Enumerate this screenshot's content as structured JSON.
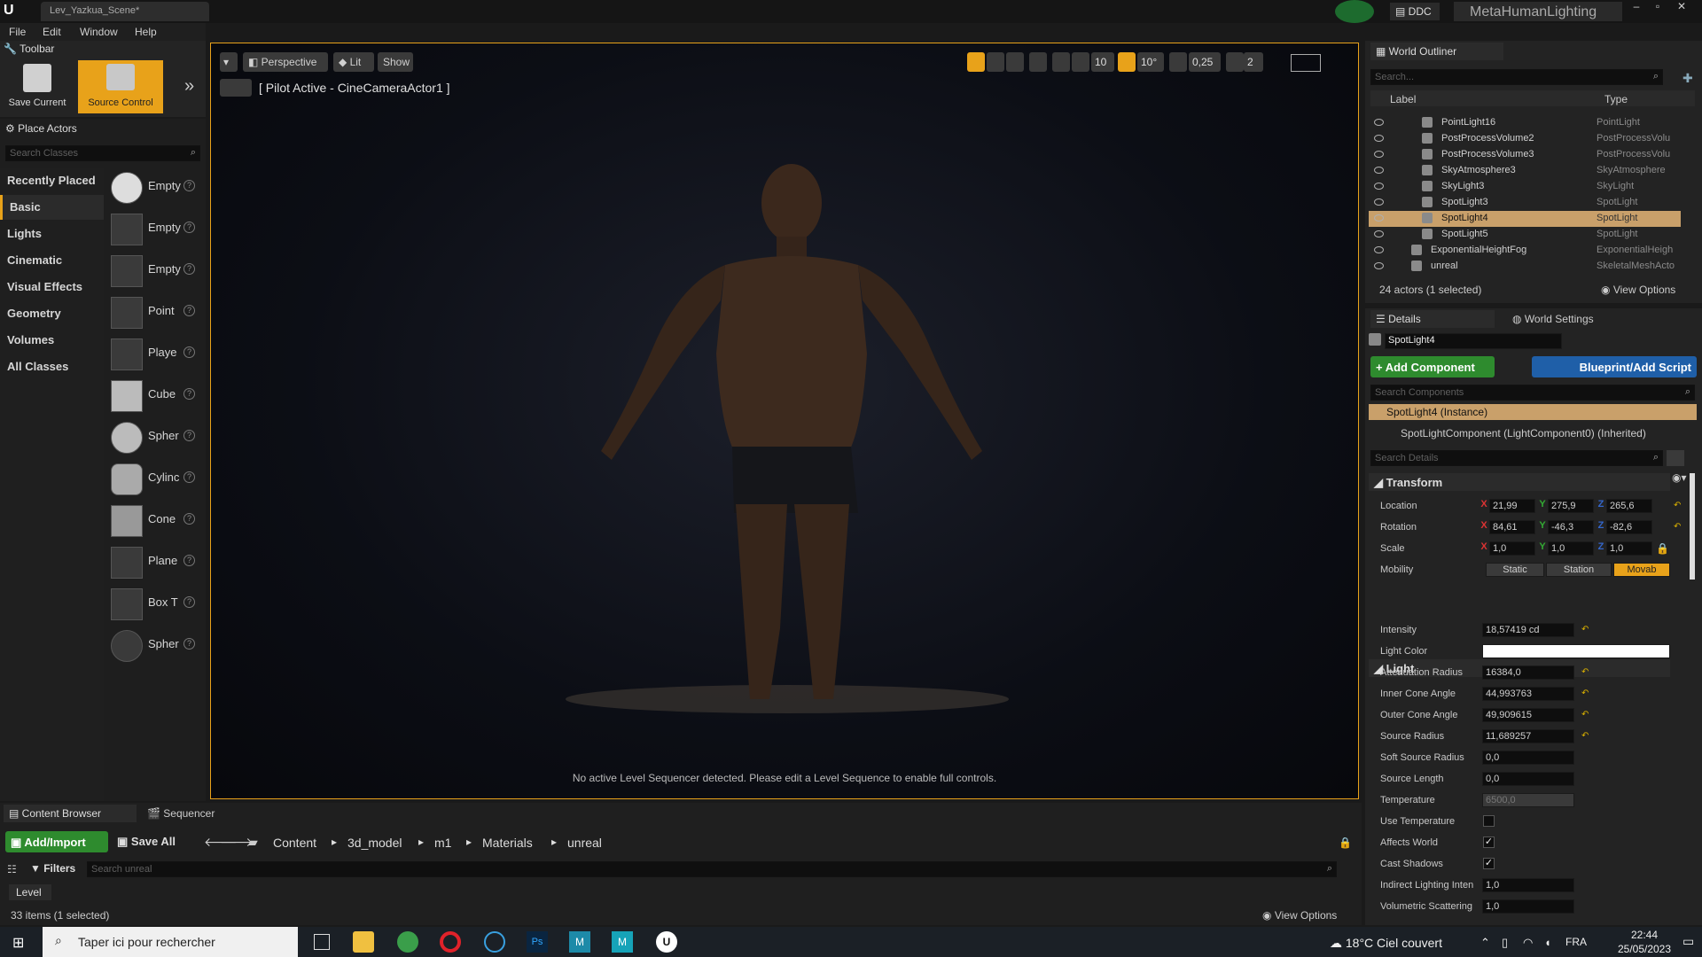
{
  "window": {
    "tab_title": "Lev_Yazkua_Scene*",
    "ddc": "DDC",
    "project": "MetaHumanLighting"
  },
  "menu": [
    "File",
    "Edit",
    "Window",
    "Help"
  ],
  "toolbar": {
    "tab": "Toolbar",
    "save": "Save Current",
    "source": "Source Control"
  },
  "place_actors": {
    "tab": "Place Actors",
    "search": "Search Classes",
    "categories": [
      "Recently Placed",
      "Basic",
      "Lights",
      "Cinematic",
      "Visual Effects",
      "Geometry",
      "Volumes",
      "All Classes"
    ],
    "items": [
      "Empty",
      "Empty",
      "Empty",
      "Point",
      "Playe",
      "Cube",
      "Spher",
      "Cylinc",
      "Cone",
      "Plane",
      "Box T",
      "Spher"
    ]
  },
  "viewport": {
    "perspective": "Perspective",
    "lit": "Lit",
    "show": "Show",
    "pilot": "[ Pilot Active - CineCameraActor1 ]",
    "grid": "10",
    "angle": "10°",
    "scale": "0,25",
    "cams": "2",
    "message": "No active Level Sequencer detected. Please edit a Level Sequence to enable full controls."
  },
  "outliner": {
    "tab": "World Outliner",
    "search": "Search...",
    "col_label": "Label",
    "col_type": "Type",
    "rows": [
      {
        "n": "PointLight16",
        "t": "PointLight"
      },
      {
        "n": "PostProcessVolume2",
        "t": "PostProcessVolu"
      },
      {
        "n": "PostProcessVolume3",
        "t": "PostProcessVolu"
      },
      {
        "n": "SkyAtmosphere3",
        "t": "SkyAtmosphere"
      },
      {
        "n": "SkyLight3",
        "t": "SkyLight"
      },
      {
        "n": "SpotLight3",
        "t": "SpotLight"
      },
      {
        "n": "SpotLight4",
        "t": "SpotLight"
      },
      {
        "n": "SpotLight5",
        "t": "SpotLight"
      },
      {
        "n": "ExponentialHeightFog",
        "t": "ExponentialHeigh"
      },
      {
        "n": "unreal",
        "t": "SkeletalMeshActo"
      }
    ],
    "count": "24 actors (1 selected)",
    "view_options": "View Options"
  },
  "details": {
    "tab": "Details",
    "tab2": "World Settings",
    "name": "SpotLight4",
    "add": "+ Add Component",
    "bp": "Blueprint/Add Script",
    "search_comp": "Search Components",
    "instance": "SpotLight4 (Instance)",
    "component": "SpotLightComponent (LightComponent0) (Inherited)",
    "search_details": "Search Details",
    "transform": "Transform",
    "location": "Location",
    "rotation": "Rotation",
    "scale": "Scale",
    "mobility": "Mobility",
    "loc": [
      "21,99",
      "275,9",
      "265,6"
    ],
    "rot": [
      "84,61",
      "-46,3",
      "-82,6"
    ],
    "scl": [
      "1,0",
      "1,0",
      "1,0"
    ],
    "mob": [
      "Static",
      "Station",
      "Movab"
    ],
    "light": "Light",
    "props": [
      {
        "l": "Intensity",
        "v": "18,57419 cd"
      },
      {
        "l": "Light Color",
        "v": ""
      },
      {
        "l": "Attenuation Radius",
        "v": "16384,0"
      },
      {
        "l": "Inner Cone Angle",
        "v": "44,993763"
      },
      {
        "l": "Outer Cone Angle",
        "v": "49,909615"
      },
      {
        "l": "Source Radius",
        "v": "11,689257"
      },
      {
        "l": "Soft Source Radius",
        "v": "0,0"
      },
      {
        "l": "Source Length",
        "v": "0,0"
      },
      {
        "l": "Temperature",
        "v": "6500,0"
      },
      {
        "l": "Use Temperature",
        "v": ""
      },
      {
        "l": "Affects World",
        "v": ""
      },
      {
        "l": "Cast Shadows",
        "v": ""
      },
      {
        "l": "Indirect Lighting Inten",
        "v": "1,0"
      },
      {
        "l": "Volumetric Scattering",
        "v": "1,0"
      }
    ]
  },
  "content": {
    "tab": "Content Browser",
    "tab2": "Sequencer",
    "add": "Add/Import",
    "save": "Save All",
    "path": [
      "Content",
      "3d_model",
      "m1",
      "Materials",
      "unreal"
    ],
    "filters": "Filters",
    "search": "Search unreal",
    "level": "Level",
    "count": "33 items (1 selected)",
    "view_options": "View Options"
  },
  "taskbar": {
    "search": "Taper ici pour rechercher",
    "weather": "18°C  Ciel couvert",
    "lang": "FRA",
    "time": "22:44",
    "date": "25/05/2023"
  }
}
